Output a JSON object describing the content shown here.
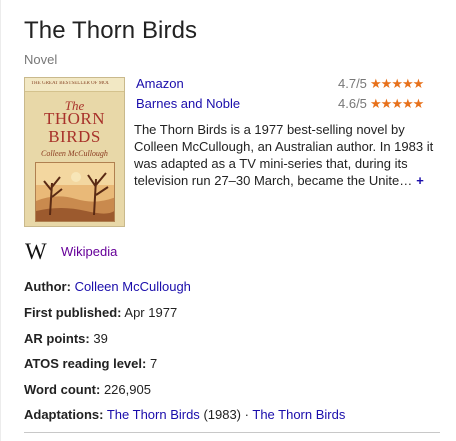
{
  "header": {
    "title": "The Thorn Birds",
    "subtitle": "Novel"
  },
  "cover": {
    "banner": "THE GREAT BESTSELLER OF MODERN TIMES",
    "line1": "The",
    "line2": "THORN",
    "line3": "BIRDS",
    "author": "Colleen McCullough"
  },
  "retailers": [
    {
      "name": "Amazon",
      "score": "4.7/5",
      "rating": 4.7
    },
    {
      "name": "Barnes and Noble",
      "score": "4.6/5",
      "rating": 4.6
    }
  ],
  "description": {
    "lines": [
      "The Thorn Birds is a 1977 best-selling novel by",
      "Colleen McCullough, an Australian author. In 1983 it",
      "was adapted as a TV mini-series that, during its",
      "television run 27–30 March, became the Unite…"
    ],
    "more": "+"
  },
  "wikipedia": {
    "logo": "W",
    "label": "Wikipedia"
  },
  "facts": {
    "author": {
      "label": "Author:",
      "value": "Colleen McCullough"
    },
    "published": {
      "label": "First published:",
      "value": "Apr 1977"
    },
    "ar_points": {
      "label": "AR points:",
      "value": "39"
    },
    "atos": {
      "label": "ATOS reading level:",
      "value": "7"
    },
    "word_count": {
      "label": "Word count:",
      "value": "226,905"
    },
    "adaptations": {
      "label": "Adaptations:",
      "first": "The Thorn Birds",
      "first_year": "(1983)",
      "separator": "·",
      "second": "The Thorn Birds"
    }
  },
  "colors": {
    "link": "#1a0dab",
    "visited_link": "#660099",
    "star": "#e7711b",
    "muted": "#777777"
  }
}
